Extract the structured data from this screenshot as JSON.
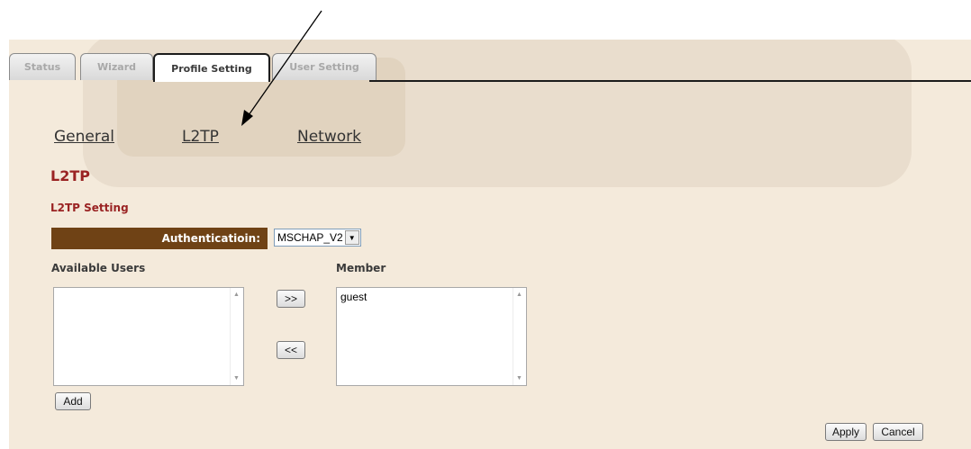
{
  "tabs": [
    {
      "label": "Status"
    },
    {
      "label": "Wizard"
    },
    {
      "label": "Profile Setting"
    },
    {
      "label": "User Setting"
    }
  ],
  "subnav": [
    {
      "label": "General"
    },
    {
      "label": "L2TP"
    },
    {
      "label": "Network"
    }
  ],
  "section_title": "L2TP",
  "subsection_title": "L2TP Setting",
  "auth": {
    "label": "Authenticatioin:",
    "value": "MSCHAP_V2"
  },
  "available_users": {
    "label": "Available Users",
    "items": []
  },
  "member": {
    "label": "Member",
    "items": [
      "guest"
    ]
  },
  "buttons": {
    "move_right": ">>",
    "move_left": "<<",
    "add": "Add",
    "apply": "Apply",
    "cancel": "Cancel"
  },
  "colors": {
    "panel_bg": "#f4eadb",
    "accent": "#9a2323",
    "auth_bar": "#6f4215"
  }
}
